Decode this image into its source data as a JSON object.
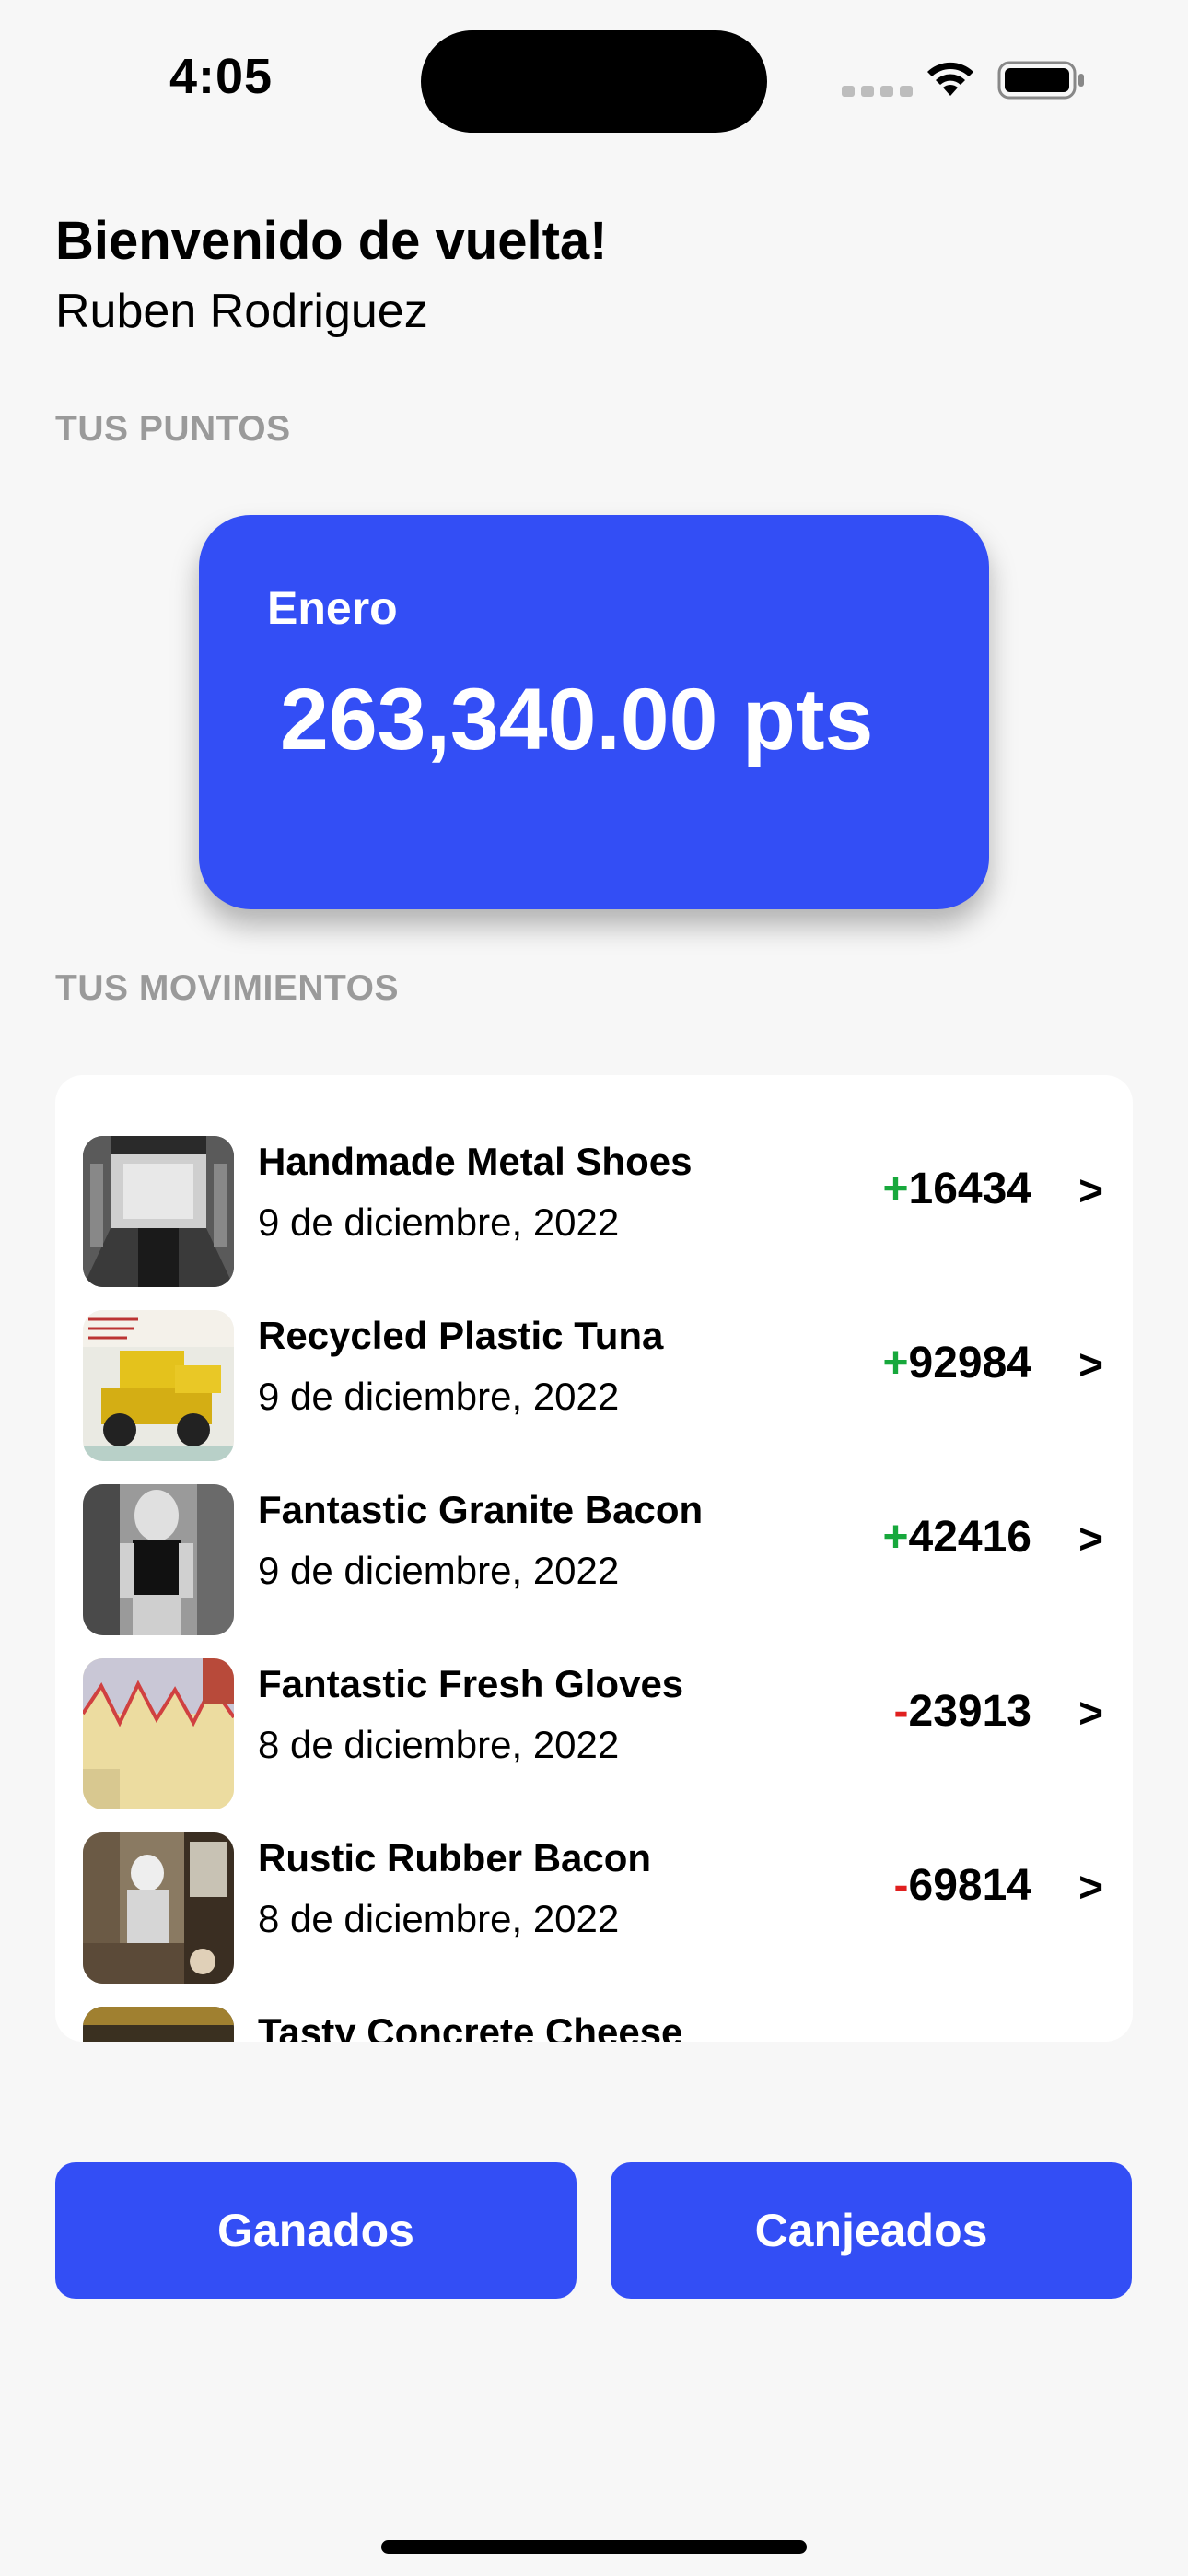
{
  "status_bar": {
    "time": "4:05",
    "icons": [
      "cellular-signal-icon",
      "wifi-icon",
      "battery-icon"
    ]
  },
  "header": {
    "greeting": "Bienvenido de vuelta!",
    "user_name": "Ruben Rodriguez"
  },
  "points_section": {
    "label": "TUS PUNTOS",
    "card": {
      "month": "Enero",
      "value": "263,340.00 pts"
    }
  },
  "movements_section": {
    "label": "TUS MOVIMIENTOS",
    "items": [
      {
        "title": "Handmade Metal Shoes",
        "date": "9 de diciembre, 2022",
        "sign": "+",
        "amount": "16434",
        "chevron": ">",
        "thumbnail": "train-interior-thumb"
      },
      {
        "title": "Recycled Plastic Tuna",
        "date": "9 de diciembre, 2022",
        "sign": "+",
        "amount": "92984",
        "chevron": ">",
        "thumbnail": "toy-bulldozer-thumb"
      },
      {
        "title": "Fantastic Granite Bacon",
        "date": "9 de diciembre, 2022",
        "sign": "+",
        "amount": "42416",
        "chevron": ">",
        "thumbnail": "woman-portrait-thumb"
      },
      {
        "title": "Fantastic Fresh Gloves",
        "date": "8 de diciembre, 2022",
        "sign": "-",
        "amount": "23913",
        "chevron": ">",
        "thumbnail": "fabric-art-thumb"
      },
      {
        "title": "Rustic Rubber Bacon",
        "date": "8 de diciembre, 2022",
        "sign": "-",
        "amount": "69814",
        "chevron": ">",
        "thumbnail": "kitchen-scene-thumb"
      },
      {
        "title": "Tasty Concrete Cheese",
        "date": "",
        "sign": "",
        "amount": "",
        "chevron": "",
        "thumbnail": "partial-thumb"
      }
    ]
  },
  "buttons": {
    "earned_label": "Ganados",
    "redeemed_label": "Canjeados"
  },
  "colors": {
    "accent": "#334ef5",
    "positive": "#17a83c",
    "negative": "#e0201f",
    "section_label": "#9a9a9a",
    "background": "#f7f7f7"
  }
}
